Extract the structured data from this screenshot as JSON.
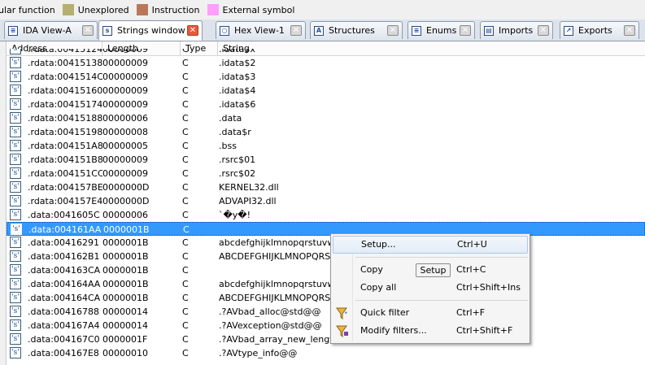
{
  "legend": [
    {
      "label": "ular function",
      "color": "#72a5d8"
    },
    {
      "label": "Unexplored",
      "color": "#b5b06f"
    },
    {
      "label": "Instruction",
      "color": "#b9785a"
    },
    {
      "label": "External symbol",
      "color": "#ff9eff"
    }
  ],
  "tabs": [
    {
      "label": "IDA View-A",
      "icon": "ida-view-icon",
      "glyph": "≡",
      "active": false
    },
    {
      "label": "Strings window",
      "icon": "strings-icon",
      "glyph": "s",
      "active": true
    },
    {
      "label": "Hex View-1",
      "icon": "hex-view-icon",
      "glyph": "○",
      "active": false
    },
    {
      "label": "Structures",
      "icon": "structures-icon",
      "glyph": "A",
      "active": false
    },
    {
      "label": "Enums",
      "icon": "enums-icon",
      "glyph": "≡",
      "active": false
    },
    {
      "label": "Imports",
      "icon": "imports-icon",
      "glyph": "▤",
      "active": false
    },
    {
      "label": "Exports",
      "icon": "exports-icon",
      "glyph": "↗",
      "active": false
    }
  ],
  "close_glyph": "✕",
  "columns": {
    "address": "Address",
    "length": "Length",
    "type": "Type",
    "string": "String"
  },
  "row_icon_glyph": "'s'",
  "rows": [
    {
      "address": ".rdata:00415124",
      "length": "00000009",
      "type": "C",
      "string": ".idata$x"
    },
    {
      "address": ".rdata:00415138",
      "length": "00000009",
      "type": "C",
      "string": ".idata$2"
    },
    {
      "address": ".rdata:0041514C",
      "length": "00000009",
      "type": "C",
      "string": ".idata$3"
    },
    {
      "address": ".rdata:00415160",
      "length": "00000009",
      "type": "C",
      "string": ".idata$4"
    },
    {
      "address": ".rdata:00415174",
      "length": "00000009",
      "type": "C",
      "string": ".idata$6"
    },
    {
      "address": ".rdata:00415188",
      "length": "00000006",
      "type": "C",
      "string": ".data"
    },
    {
      "address": ".rdata:00415198",
      "length": "00000008",
      "type": "C",
      "string": ".data$r"
    },
    {
      "address": ".rdata:004151A8",
      "length": "00000005",
      "type": "C",
      "string": ".bss"
    },
    {
      "address": ".rdata:004151B8",
      "length": "00000009",
      "type": "C",
      "string": ".rsrc$01"
    },
    {
      "address": ".rdata:004151CC",
      "length": "00000009",
      "type": "C",
      "string": ".rsrc$02"
    },
    {
      "address": ".rdata:004157BE",
      "length": "0000000D",
      "type": "C",
      "string": "KERNEL32.dll"
    },
    {
      "address": ".rdata:004157E4",
      "length": "0000000D",
      "type": "C",
      "string": "ADVAPI32.dll"
    },
    {
      "address": ".data:0041605C",
      "length": "00000006",
      "type": "C",
      "string": "`�y�!"
    },
    {
      "address": ".data:004161AA",
      "length": "0000001B",
      "type": "C",
      "string": "",
      "selected": true
    },
    {
      "address": ".data:00416291",
      "length": "0000001B",
      "type": "C",
      "string": "abcdefghijklmnopqrstuvwxyz"
    },
    {
      "address": ".data:004162B1",
      "length": "0000001B",
      "type": "C",
      "string": "ABCDEFGHIJKLMNOPQRSTUVWXYZ"
    },
    {
      "address": ".data:004163CA",
      "length": "0000001B",
      "type": "C",
      "string": ""
    },
    {
      "address": ".data:004164AA",
      "length": "0000001B",
      "type": "C",
      "string": "abcdefghijklmnopqrstuvwxyz"
    },
    {
      "address": ".data:004164CA",
      "length": "0000001B",
      "type": "C",
      "string": "ABCDEFGHIJKLMNOPQRSTUVWXYZ"
    },
    {
      "address": ".data:00416788",
      "length": "00000014",
      "type": "C",
      "string": ".?AVbad_alloc@std@@"
    },
    {
      "address": ".data:004167A4",
      "length": "00000014",
      "type": "C",
      "string": ".?AVexception@std@@"
    },
    {
      "address": ".data:004167C0",
      "length": "0000001F",
      "type": "C",
      "string": ".?AVbad_array_new_length@std@@"
    },
    {
      "address": ".data:004167E8",
      "length": "00000010",
      "type": "C",
      "string": ".?AVtype_info@@"
    }
  ],
  "context_menu": {
    "items": [
      {
        "label": "Setup...",
        "shortcut": "Ctrl+U",
        "highlighted": true,
        "icon": ""
      },
      {
        "label": "Copy",
        "shortcut": "Ctrl+C",
        "highlighted": false,
        "icon": ""
      },
      {
        "label": "Copy all",
        "shortcut": "Ctrl+Shift+Ins",
        "highlighted": false,
        "icon": ""
      },
      {
        "label": "Quick filter",
        "shortcut": "Ctrl+F",
        "highlighted": false,
        "icon": "quick-filter-icon"
      },
      {
        "label": "Modify filters...",
        "shortcut": "Ctrl+Shift+F",
        "highlighted": false,
        "icon": "modify-filters-icon"
      }
    ],
    "tooltip": "Setup"
  }
}
